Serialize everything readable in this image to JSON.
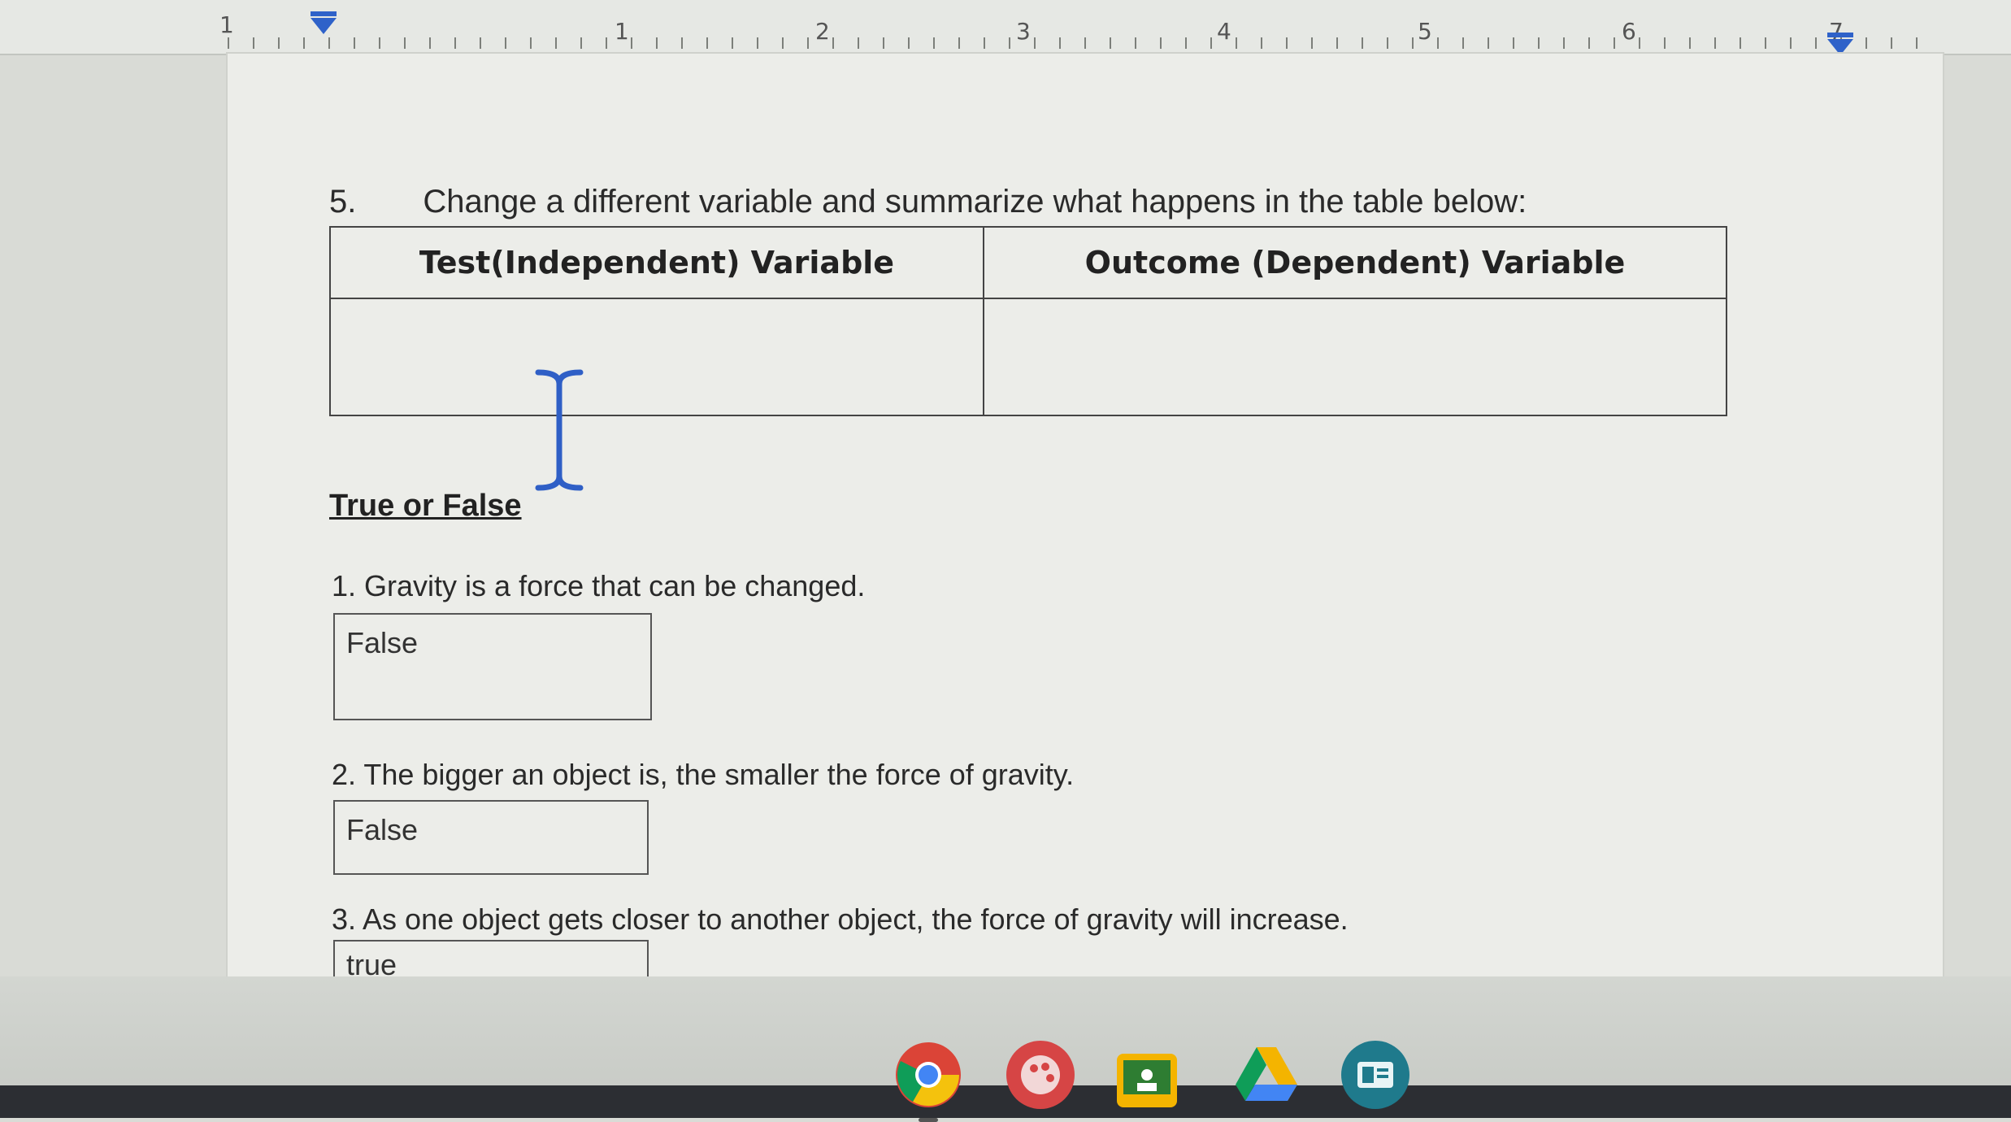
{
  "ruler": {
    "left_label": "1",
    "numbers": [
      "1",
      "2",
      "3",
      "4",
      "5",
      "6",
      "7"
    ]
  },
  "document": {
    "question5": {
      "number": "5.",
      "text": "Change a different variable and summarize what happens in the table below:"
    },
    "table": {
      "headers": [
        "Test(Independent) Variable",
        "Outcome (Dependent) Variable"
      ],
      "cells": [
        "",
        ""
      ]
    },
    "true_false": {
      "title": "True or False",
      "questions": [
        {
          "text": "1.  Gravity is a force that can be changed.",
          "answer": "False"
        },
        {
          "text": "2.  The bigger an object is, the smaller the force of gravity.",
          "answer": "False"
        },
        {
          "text": "3.  As one object gets closer to another object, the force of gravity will increase.",
          "answer": "true"
        }
      ]
    }
  },
  "shelf": {
    "apps": [
      "chrome-icon",
      "paint-palette-icon",
      "classroom-icon",
      "google-drive-icon",
      "app-icon"
    ]
  }
}
